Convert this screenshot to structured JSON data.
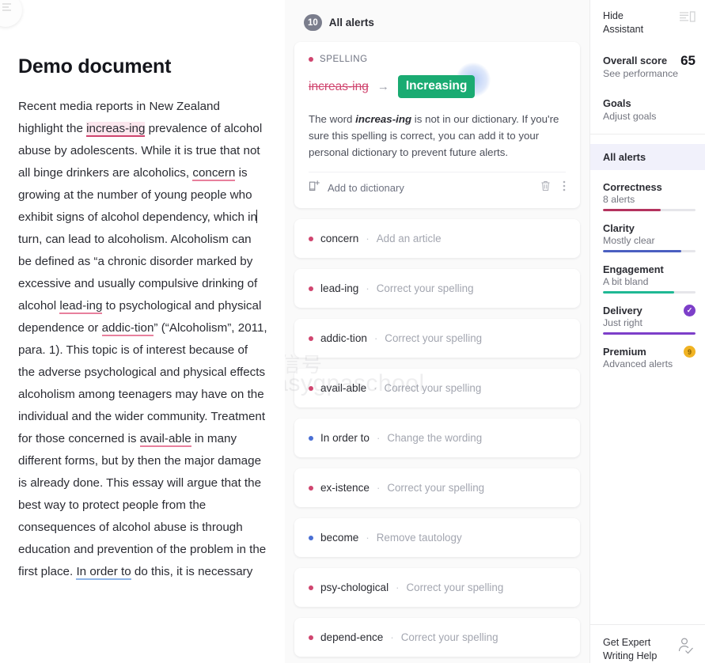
{
  "document": {
    "title": "Demo document",
    "paragraph_segments": [
      {
        "text": "Recent media reports in New Zealand highlight the ",
        "style": "plain"
      },
      {
        "text": "increas-ing",
        "style": "spelling-highlight"
      },
      {
        "text": " prevalence of alcohol abuse by adolescents. While it is true that not all binge drinkers are alcoholics, ",
        "style": "plain"
      },
      {
        "text": "concern",
        "style": "underline-red"
      },
      {
        "text": " is growing at the number of young people who exhibit signs of alcohol dependency, which in",
        "style": "plain"
      },
      {
        "text": "",
        "style": "caret"
      },
      {
        "text": "turn, can lead to alcoholism. Alcoholism can be defined as “a chronic disorder marked by excessive and usually compulsive drinking of alcohol ",
        "style": "plain"
      },
      {
        "text": "lead-ing",
        "style": "underline-red"
      },
      {
        "text": " to psychological and physical dependence or ",
        "style": "plain"
      },
      {
        "text": "addic-tion",
        "style": "underline-red"
      },
      {
        "text": "” (“Alcoholism”, 2011, para. 1). This topic is of interest because of the adverse psychological and physical effects alcoholism among teenagers may have on the individual and the wider community. Treatment for those concerned is ",
        "style": "plain"
      },
      {
        "text": "avail-able",
        "style": "underline-red"
      },
      {
        "text": " in many different forms, but by then the major damage is already done. This essay will argue that the best way to protect people from the consequences of alcohol abuse is through education and prevention of the problem in the first place. ",
        "style": "plain"
      },
      {
        "text": "In order to",
        "style": "underline-blue"
      },
      {
        "text": " do this, it is necessary",
        "style": "plain"
      }
    ]
  },
  "alerts_panel": {
    "count": "10",
    "header_label": "All alerts",
    "open_card": {
      "category": "SPELLING",
      "category_color": "#d0456f",
      "original": "increas-ing",
      "arrow": "→",
      "suggestion": "Increasing",
      "suggestion_color": "#1aab72",
      "explanation_pre": "The word ",
      "explanation_word": "increas-ing",
      "explanation_post": " is not in our dictionary. If you're sure this spelling is correct, you can add it to your personal dictionary to prevent future alerts.",
      "add_to_dictionary": "Add to dictionary"
    },
    "rows": [
      {
        "term": "concern",
        "sep": "·",
        "action": "Add an article",
        "color": "#d0456f"
      },
      {
        "term": "lead-ing",
        "sep": "·",
        "action": "Correct your spelling",
        "color": "#d0456f"
      },
      {
        "term": "addic-tion",
        "sep": "·",
        "action": "Correct your spelling",
        "color": "#d0456f"
      },
      {
        "term": "avail-able",
        "sep": "·",
        "action": "Correct your spelling",
        "color": "#d0456f"
      },
      {
        "term": "In order to",
        "sep": "·",
        "action": "Change the wording",
        "color": "#4a6fd4"
      },
      {
        "term": "ex-istence",
        "sep": "·",
        "action": "Correct your spelling",
        "color": "#d0456f"
      },
      {
        "term": "become",
        "sep": "·",
        "action": "Remove tautology",
        "color": "#4a6fd4"
      },
      {
        "term": "psy-chological",
        "sep": "·",
        "action": "Correct your spelling",
        "color": "#d0456f"
      },
      {
        "term": "depend-ence",
        "sep": "·",
        "action": "Correct your spelling",
        "color": "#d0456f"
      }
    ],
    "watermark_line1": "微信号",
    "watermark_line2": "easygpaschool"
  },
  "sidebar": {
    "hide_assistant_line1": "Hide",
    "hide_assistant_line2": "Assistant",
    "overall_score_label": "Overall score",
    "overall_score_value": "65",
    "see_performance": "See performance",
    "goals_label": "Goals",
    "adjust_goals": "Adjust goals",
    "all_alerts": "All alerts",
    "goals": [
      {
        "name": "Correctness",
        "sub": "8 alerts",
        "fill": 62,
        "color": "#b4335e",
        "badge": ""
      },
      {
        "name": "Clarity",
        "sub": "Mostly clear",
        "fill": 85,
        "color": "#4a5fc1",
        "badge": ""
      },
      {
        "name": "Engagement",
        "sub": "A bit bland",
        "fill": 77,
        "color": "#1fb894",
        "badge": ""
      },
      {
        "name": "Delivery",
        "sub": "Just right",
        "fill": 100,
        "color": "#7d3fc9",
        "badge": "✓"
      },
      {
        "name": "Premium",
        "sub": "Advanced alerts",
        "fill": 0,
        "color": "#f0b323",
        "badge": "9"
      }
    ],
    "expert_line1": "Get Expert",
    "expert_line2": "Writing Help"
  }
}
